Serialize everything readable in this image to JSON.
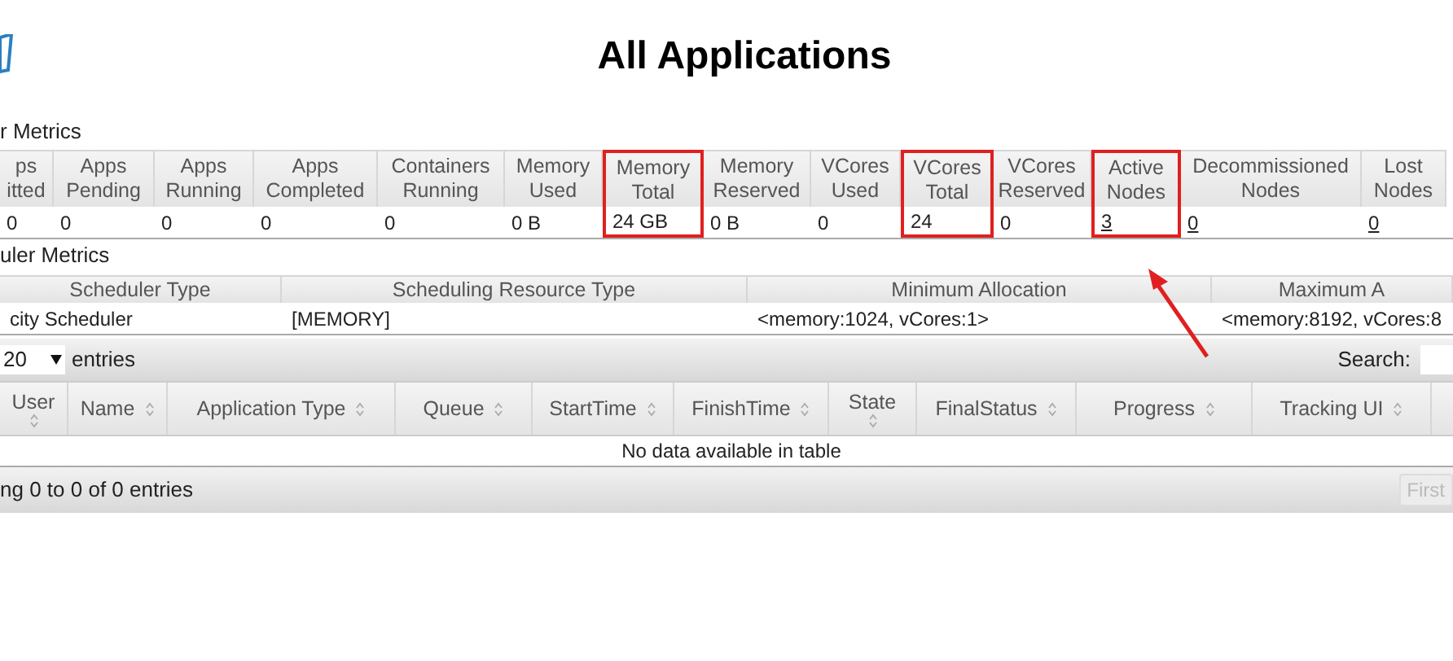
{
  "page_title": "All Applications",
  "cluster_metrics": {
    "title": "r Metrics",
    "columns": [
      {
        "header": "ps itted",
        "value": "0",
        "link": false,
        "highlighted": false
      },
      {
        "header": "Apps Pending",
        "value": "0",
        "link": false,
        "highlighted": false
      },
      {
        "header": "Apps Running",
        "value": "0",
        "link": false,
        "highlighted": false
      },
      {
        "header": "Apps Completed",
        "value": "0",
        "link": false,
        "highlighted": false
      },
      {
        "header": "Containers Running",
        "value": "0",
        "link": false,
        "highlighted": false
      },
      {
        "header": "Memory Used",
        "value": "0 B",
        "link": false,
        "highlighted": false
      },
      {
        "header": "Memory Total",
        "value": "24 GB",
        "link": false,
        "highlighted": true
      },
      {
        "header": "Memory Reserved",
        "value": "0 B",
        "link": false,
        "highlighted": false
      },
      {
        "header": "VCores Used",
        "value": "0",
        "link": false,
        "highlighted": false
      },
      {
        "header": "VCores Total",
        "value": "24",
        "link": false,
        "highlighted": true
      },
      {
        "header": "VCores Reserved",
        "value": "0",
        "link": false,
        "highlighted": false
      },
      {
        "header": "Active Nodes",
        "value": "3",
        "link": true,
        "highlighted": true
      },
      {
        "header": "Decommissioned Nodes",
        "value": "0",
        "link": true,
        "highlighted": false
      },
      {
        "header": "Lost Nodes",
        "value": "0",
        "link": true,
        "highlighted": false
      }
    ]
  },
  "scheduler_metrics": {
    "title": "uler Metrics",
    "columns": [
      {
        "header": "Scheduler Type",
        "value": "city Scheduler"
      },
      {
        "header": "Scheduling Resource Type",
        "value": "[MEMORY]"
      },
      {
        "header": "Minimum Allocation",
        "value": "<memory:1024, vCores:1>"
      },
      {
        "header": "Maximum A",
        "value": "<memory:8192, vCores:8"
      }
    ]
  },
  "applications": {
    "page_size": "20",
    "entries_label": "entries",
    "search_label": "Search:",
    "columns": [
      "User",
      "Name",
      "Application Type",
      "Queue",
      "StartTime",
      "FinishTime",
      "State",
      "FinalStatus",
      "Progress",
      "Tracking UI"
    ],
    "empty_message": "No data available in table",
    "info": "ng 0 to 0 of 0 entries",
    "first_button": "First"
  }
}
